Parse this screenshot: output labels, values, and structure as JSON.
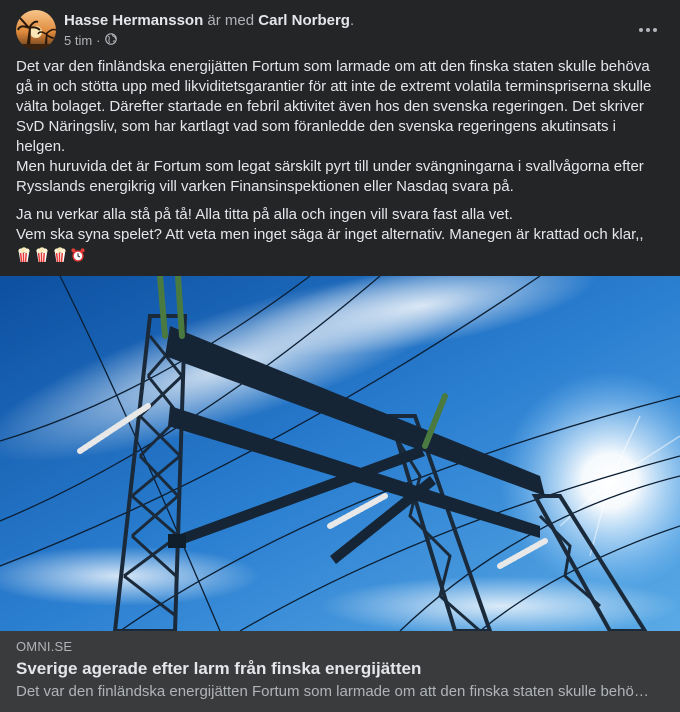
{
  "post": {
    "author": "Hasse Hermansson",
    "with_text": "är med",
    "tagged": "Carl Norberg",
    "tagged_suffix": ".",
    "time": "5 tim",
    "time_separator": "·",
    "privacy_icon": "globe-icon",
    "more_icon": "more-options-icon",
    "paragraphs": [
      "Det var den finländska energijätten Fortum som larmade om att den finska staten skulle behöva gå in och stötta upp med likviditetsgarantier för att inte de extremt volatila terminspriserna skulle välta bolaget. Därefter startade en febril aktivitet även hos den svenska regeringen. Det skriver SvD Näringsliv, som har kartlagt vad som föranledde den svenska regeringens akutinsats i helgen.\n    Men huruvida det är Fortum som legat särskilt pyrt till under svängningarna i svallvågorna efter Rysslands energikrig vill varken Finansinspektionen eller Nasdaq svara på.",
      "Ja nu verkar alla stå på tå! Alla titta på alla och ingen vill svara fast alla vet.\nVem ska syna spelet? Att veta men inget säga är inget alternativ. Manegen är krattad och klar,,"
    ],
    "emojis": [
      "popcorn",
      "popcorn",
      "popcorn",
      "alarm-clock"
    ]
  },
  "photo": {
    "subject": "power-line-pylon-against-sunny-sky"
  },
  "link": {
    "domain": "OMNI.SE",
    "title": "Sverige agerade efter larm från finska energijätten",
    "description": "Det var den finländska energijätten Fortum som larmade om att den finska staten skulle behö…"
  },
  "colors": {
    "background": "#242526",
    "text_primary": "#e4e6eb",
    "text_secondary": "#b0b3b8",
    "link_card": "#3a3b3c"
  }
}
